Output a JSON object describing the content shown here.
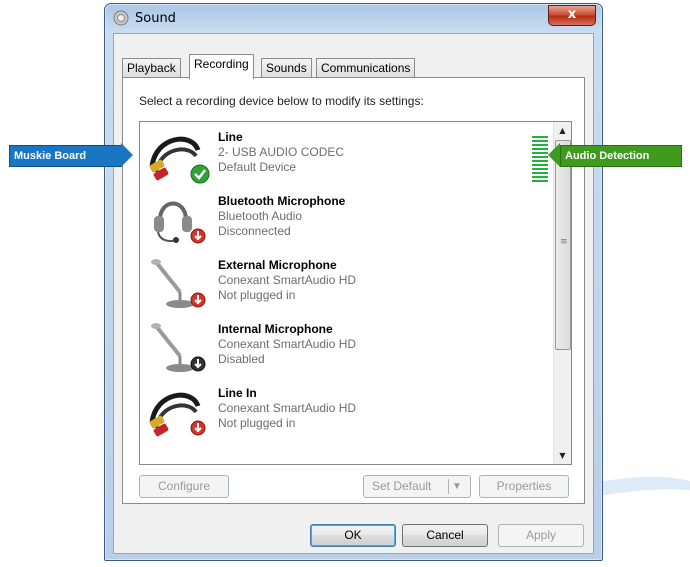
{
  "window": {
    "title": "Sound",
    "close_glyph": "x"
  },
  "tabs": [
    "Playback",
    "Recording",
    "Sounds",
    "Communications"
  ],
  "active_tab": "Recording",
  "instruction": "Select a recording device below to modify its settings:",
  "devices": [
    {
      "name": "Line",
      "line1": "2- USB AUDIO  CODEC",
      "line2": "Default Device",
      "icon": "line-cable-icon",
      "status_icon": "check-icon",
      "level": 1
    },
    {
      "name": "Bluetooth Microphone",
      "line1": "Bluetooth Audio",
      "line2": "Disconnected",
      "icon": "headset-icon",
      "status_icon": "down-arrow-icon"
    },
    {
      "name": "External Microphone",
      "line1": "Conexant SmartAudio HD",
      "line2": "Not plugged in",
      "icon": "microphone-icon",
      "status_icon": "down-arrow-icon"
    },
    {
      "name": "Internal Microphone",
      "line1": "Conexant SmartAudio HD",
      "line2": "Disabled",
      "icon": "microphone-icon",
      "status_icon": "down-arrow-icon"
    },
    {
      "name": "Line In",
      "line1": "Conexant SmartAudio HD",
      "line2": "Not plugged in",
      "icon": "line-cable-icon",
      "status_icon": "down-arrow-icon"
    }
  ],
  "buttons": {
    "configure": "Configure",
    "set_default": "Set Default",
    "properties": "Properties",
    "ok": "OK",
    "cancel": "Cancel",
    "apply": "Apply"
  },
  "callouts": {
    "left": "Muskie Board",
    "right": "Audio Detection"
  },
  "colors": {
    "callout_left": "#1976c2",
    "callout_right": "#3f9b1d",
    "level_meter": "#23b33c"
  }
}
